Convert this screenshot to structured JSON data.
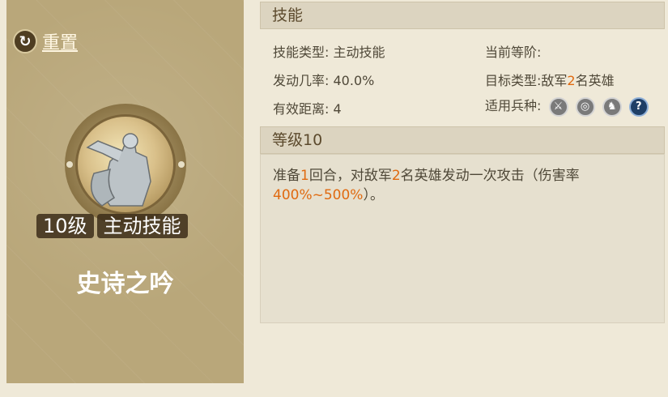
{
  "reset": {
    "label": "重置",
    "icon": "reset-icon"
  },
  "hero": {
    "level_tag": "10级",
    "type_tag": "主动技能",
    "skill_name": "史诗之吟"
  },
  "skill": {
    "section_title": "技能",
    "type_label": "技能类型:",
    "type_value": "主动技能",
    "rank_label": "当前等阶:",
    "rank_value": "",
    "rate_label": "发动几率:",
    "rate_value": "40.0%",
    "target_label": "目标类型:",
    "target_prefix": "敌军",
    "target_num": "2",
    "target_suffix": "名英雄",
    "range_label": "有效距离:",
    "range_value": "4",
    "troop_label": "适用兵种:",
    "troop_icons": [
      "sword-icon",
      "target-icon",
      "horse-icon",
      "question-icon"
    ]
  },
  "level": {
    "section_title": "等级10",
    "desc_1": "准备",
    "desc_num1": "1",
    "desc_2": "回合，对敌军",
    "desc_num2": "2",
    "desc_3": "名英雄发动一次攻击（伤害率",
    "desc_rate": "400%~500%",
    "desc_4": "）。"
  },
  "colors": {
    "accent": "#e06a10",
    "panel": "#b9a77a",
    "background": "#efe9d8"
  }
}
